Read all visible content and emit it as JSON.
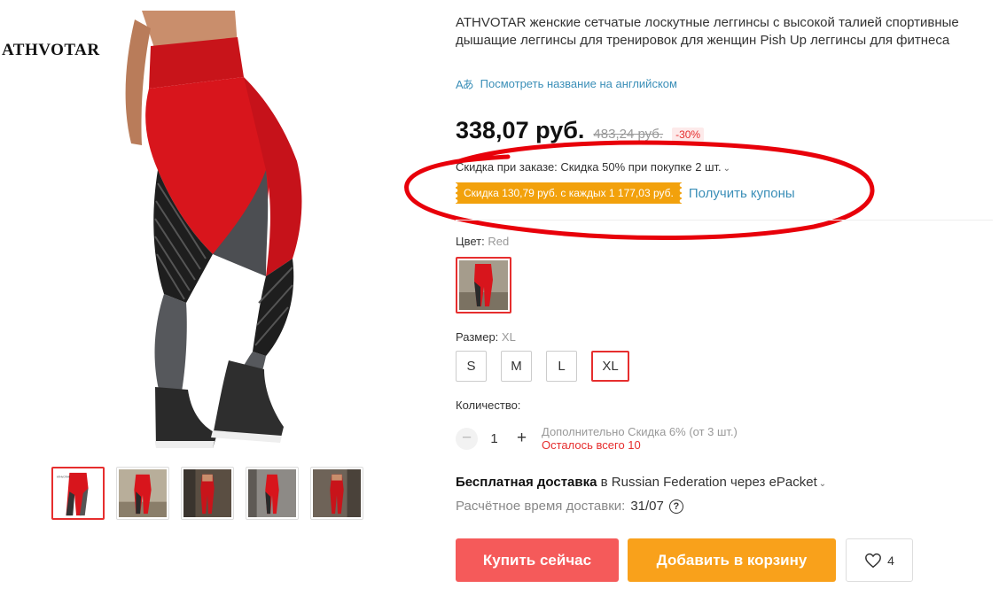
{
  "gallery": {
    "brand": "ATHVOTAR",
    "thumb_count": 5
  },
  "product": {
    "title": "ATHVOTAR женские сетчатые лоскутные леггинсы с высокой талией спортивные дышащие леггинсы для тренировок для женщин Pish Up леггинсы для фитнеса",
    "translate_icon": "Aあ",
    "translate_link": "Посмотреть название на английском"
  },
  "price": {
    "current": "338,07 руб.",
    "old": "483,24 руб.",
    "discount": "-30%"
  },
  "promo": {
    "order_discount": "Скидка при заказе: Скидка 50% при покупке 2 шт.",
    "coupon_tag": "Скидка 130,79 руб. с каждых 1 177,03 руб.",
    "coupon_link": "Получить купоны",
    "annotation_color": "#e8000a"
  },
  "color": {
    "label": "Цвет:",
    "value": "Red"
  },
  "size": {
    "label": "Размер:",
    "value": "XL",
    "options": [
      "S",
      "M",
      "L",
      "XL"
    ]
  },
  "quantity": {
    "label": "Количество:",
    "value": "1",
    "extra_discount": "Дополнительно Скидка 6% (от 3 шт.)",
    "stock_left": "Осталось всего 10"
  },
  "shipping": {
    "free": "Бесплатная доставка",
    "route": "в Russian Federation через ePacket",
    "eta_label": "Расчётное время доставки:",
    "eta_date": "31/07"
  },
  "actions": {
    "buy_now": "Купить сейчас",
    "add_to_cart": "Добавить в корзину",
    "wishlist_count": "4"
  },
  "colors": {
    "accent_red": "#e62e2e",
    "buy_button": "#f55a5a",
    "cart_button": "#f9a11b",
    "link_blue": "#3b8fb8",
    "coupon_orange": "#f2a10c"
  }
}
